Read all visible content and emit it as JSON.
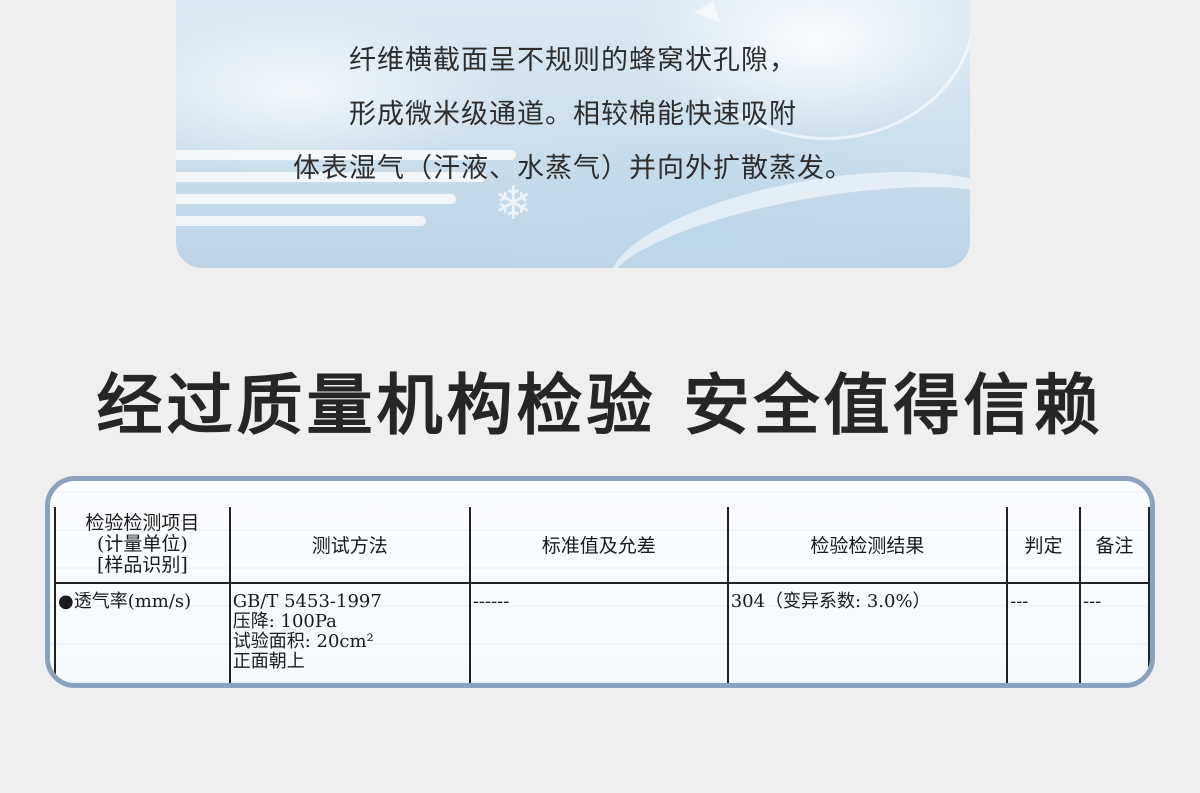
{
  "hero": {
    "lines": [
      "纤维横截面呈不规则的蜂窝状孔隙，",
      "形成微米级通道。相较棉能快速吸附",
      "体表湿气（汗液、水蒸气）并向外扩散蒸发。"
    ],
    "background_icon": "snowflake-icon"
  },
  "headline": "经过质量机构检验 安全值得信赖",
  "report": {
    "border_color": "#8aa2bf",
    "headers": {
      "item_line1": "检验检测项目",
      "item_line2": "(计量单位)",
      "item_line3": "[样品识别]",
      "method": "测试方法",
      "standard": "标准值及允差",
      "result": "检验检测结果",
      "judgement": "判定",
      "remarks": "备注"
    },
    "row": {
      "item": "●透气率(mm/s)",
      "method_line1": "GB/T 5453-1997",
      "method_line2": "压降: 100Pa",
      "method_line3": "试验面积: 20cm²",
      "method_line4": "正面朝上",
      "standard": "------",
      "result": "304（变异系数: 3.0%）",
      "judgement": "---",
      "remarks": "---"
    }
  }
}
